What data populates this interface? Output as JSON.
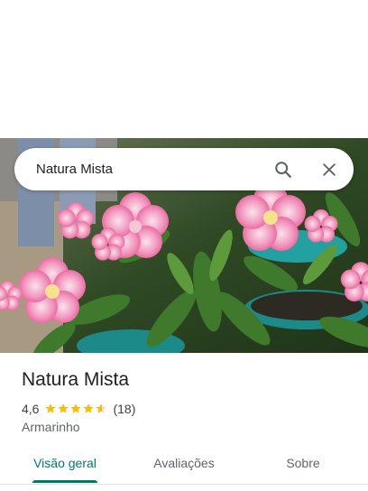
{
  "search": {
    "query": "Natura Mista",
    "search_icon": "search-icon",
    "close_icon": "close-icon"
  },
  "photo": {
    "subject": "pink flowers photo"
  },
  "place": {
    "name": "Natura Mista",
    "rating": "4,6",
    "rating_stars": 4.6,
    "review_count": "(18)",
    "category": "Armarinho"
  },
  "tabs": [
    {
      "label": "Visão geral",
      "active": true
    },
    {
      "label": "Avaliações",
      "active": false
    },
    {
      "label": "Sobre",
      "active": false
    }
  ],
  "colors": {
    "accent": "#00796b",
    "star": "#fbbc04"
  }
}
